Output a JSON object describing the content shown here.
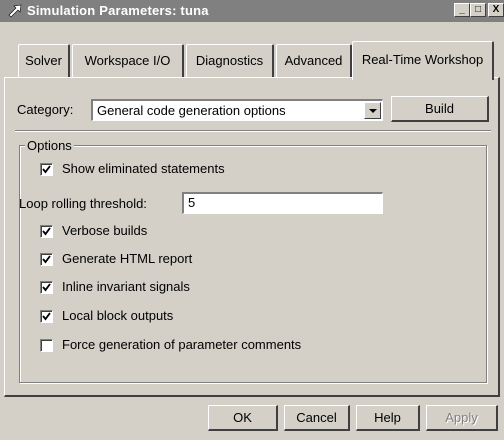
{
  "window": {
    "title": "Simulation Parameters: tuna",
    "controls": {
      "minimize": "_",
      "maximize": "□",
      "close": "X"
    }
  },
  "tabs": [
    {
      "label": "Solver",
      "active": false
    },
    {
      "label": "Workspace I/O",
      "active": false
    },
    {
      "label": "Diagnostics",
      "active": false
    },
    {
      "label": "Advanced",
      "active": false
    },
    {
      "label": "Real-Time Workshop",
      "active": true
    }
  ],
  "category": {
    "label": "Category:",
    "selected": "General code generation options"
  },
  "build_label": "Build",
  "options": {
    "title": "Options",
    "show_eliminated": {
      "label": "Show eliminated statements",
      "checked": true
    },
    "loop_rolling": {
      "label": "Loop rolling threshold:",
      "value": "5"
    },
    "verbose": {
      "label": "Verbose builds",
      "checked": true
    },
    "html_report": {
      "label": "Generate HTML report",
      "checked": true
    },
    "inline_invariant": {
      "label": "Inline invariant signals",
      "checked": true
    },
    "local_block": {
      "label": "Local block outputs",
      "checked": true
    },
    "force_param_comments": {
      "label": "Force generation of parameter comments",
      "checked": false
    }
  },
  "footer": {
    "ok": "OK",
    "cancel": "Cancel",
    "help": "Help",
    "apply": "Apply"
  },
  "icons": {
    "app": "simulink-arrow-icon",
    "check": "checkmark-icon"
  }
}
